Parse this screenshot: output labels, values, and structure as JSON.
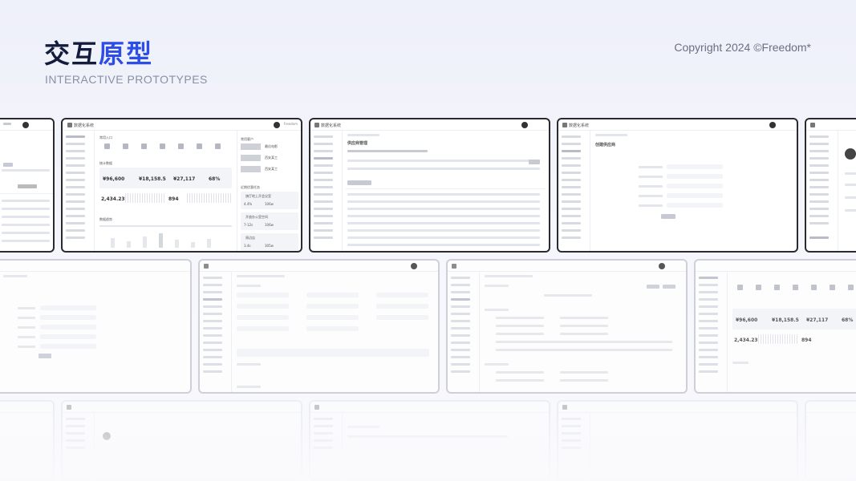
{
  "header": {
    "title_dark": "交互",
    "title_blue": "原型",
    "subtitle": "INTERACTIVE PROTOTYPES",
    "copyright": "Copyright 2024 ©Freedom*"
  },
  "colors": {
    "title_dark": "#141b3c",
    "title_blue": "#2c4de6",
    "frame_border": "#2a2a30"
  },
  "mockups": {
    "system_name": "数据化系统",
    "user": "Freedom",
    "dashboard": {
      "section_quick": "常用入口",
      "section_stats": "统计数据",
      "stat_a": "¥96,600",
      "stat_b": "¥18,158.5",
      "stat_c": "¥27,117",
      "stat_d": "68%",
      "stat_e": "2,434.23",
      "stat_f": "894",
      "section_trend": "数据趋势",
      "side_title": "常用客户",
      "side_name_1": "最佳电影",
      "side_name_2": "西安某工",
      "side_name_3": "西安某工",
      "side_section": "近期优惠任务",
      "task_1": "旗厅地上开会议室",
      "task_2": "开放办公室空间",
      "task_3": "周边店",
      "val_1": "4.4%",
      "val_2": "106w",
      "val_3": "7-12s",
      "val_4": "106w",
      "val_5": "3.4s",
      "val_6": "305w"
    },
    "list_page": {
      "title": "供应商管理"
    },
    "form_page": {
      "title": "创建供应商"
    }
  }
}
